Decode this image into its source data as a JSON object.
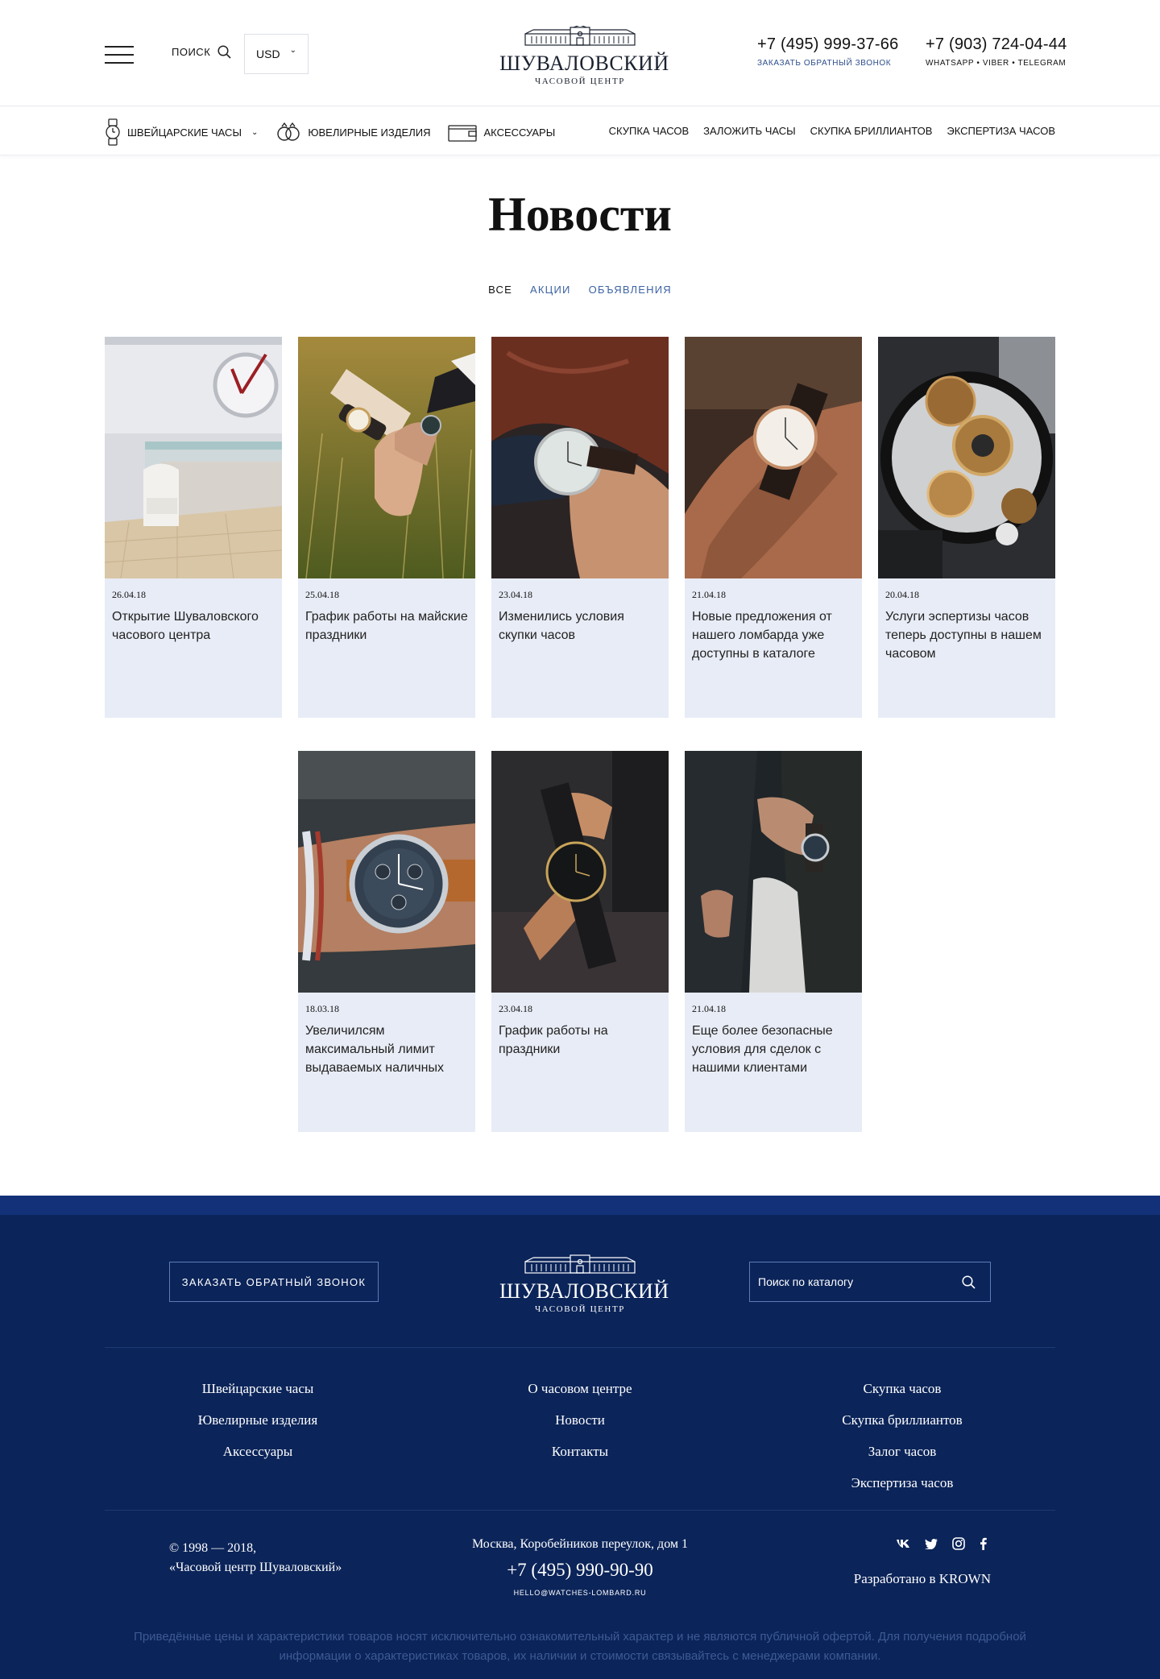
{
  "header": {
    "search_label": "ПОИСК",
    "currency": "USD",
    "logo_name": "ШУВАЛОВСКИЙ",
    "logo_sub": "ЧАСОВОЙ ЦЕНТР",
    "phone1": "+7 (495) 999-37-66",
    "phone1_sub": "ЗАКАЗАТЬ ОБРАТНЫЙ ЗВОНОК",
    "phone2": "+7 (903) 724-04-44",
    "phone2_sub": "WHATSAPP  •  VIBER  •  TELEGRAM"
  },
  "nav": {
    "categories": [
      {
        "label": "ШВЕЙЦАРСКИЕ ЧАСЫ",
        "icon": "watch-icon"
      },
      {
        "label": "ЮВЕЛИРНЫЕ ИЗДЕЛИЯ",
        "icon": "rings-icon"
      },
      {
        "label": "АКСЕССУАРЫ",
        "icon": "wallet-icon"
      }
    ],
    "links": [
      "СКУПКА ЧАСОВ",
      "ЗАЛОЖИТЬ ЧАСЫ",
      "СКУПКА БРИЛЛИАНТОВ",
      "ЭКСПЕРТИЗА ЧАСОВ"
    ]
  },
  "main": {
    "title": "Новости",
    "filters": [
      "ВСЕ",
      "АКЦИИ",
      "ОБЪЯВЛЕНИЯ"
    ],
    "active_filter": "ВСЕ"
  },
  "news": [
    {
      "date": "26.04.18",
      "title": "Открытие Шуваловского часового центра"
    },
    {
      "date": "25.04.18",
      "title": "График работы на майские праздники"
    },
    {
      "date": "23.04.18",
      "title": "Изменились условия скупки часов"
    },
    {
      "date": "21.04.18",
      "title": "Новые предложения от нашего ломбарда уже доступны в каталоге"
    },
    {
      "date": "20.04.18",
      "title": "Услуги эспертизы часов теперь доступны в нашем часовом"
    },
    {
      "date": "18.03.18",
      "title": "Увеличилсям максимальный лимит выдаваемых наличных"
    },
    {
      "date": "23.04.18",
      "title": "График работы на праздники"
    },
    {
      "date": "21.04.18",
      "title": "Еще более безопасные условия для сделок с нашими клиентами"
    }
  ],
  "footer": {
    "callback": "ЗАКАЗАТЬ ОБРАТНЫЙ ЗВОНОК",
    "logo_name": "ШУВАЛОВСКИЙ",
    "logo_sub": "ЧАСОВОЙ ЦЕНТР",
    "search_placeholder": "Поиск по каталогу",
    "col1": [
      "Швейцарские часы",
      "Ювелирные изделия",
      "Аксессуары"
    ],
    "col2": [
      "О часовом центре",
      "Новости",
      "Контакты"
    ],
    "col3": [
      "Скупка часов",
      "Скупка бриллиантов",
      "Залог часов",
      "Экспертиза часов"
    ],
    "copyright_line1": "© 1998 — 2018,",
    "copyright_line2": "«Часовой центр Шуваловский»",
    "address": "Москва, Коробейников переулок, дом 1",
    "phone": "+7 (495) 990-90-90",
    "email": "HELLO@WATCHES-LOMBARD.RU",
    "social": [
      "vk-icon",
      "twitter-icon",
      "instagram-icon",
      "facebook-icon"
    ],
    "developer": "Разработано в KROWN",
    "disclaimer": "Приведённые цены и характеристики товаров носят исключительно ознакомительный характер и не являются публичной офертой. Для получения подробной информации о характеристиках товаров, их наличии и стоимости связывайтесь с менеджерами компании."
  },
  "colors": {
    "footer_bg": "#0b2459",
    "card_bg": "#e8ecf6",
    "accent": "#3d63a3"
  }
}
